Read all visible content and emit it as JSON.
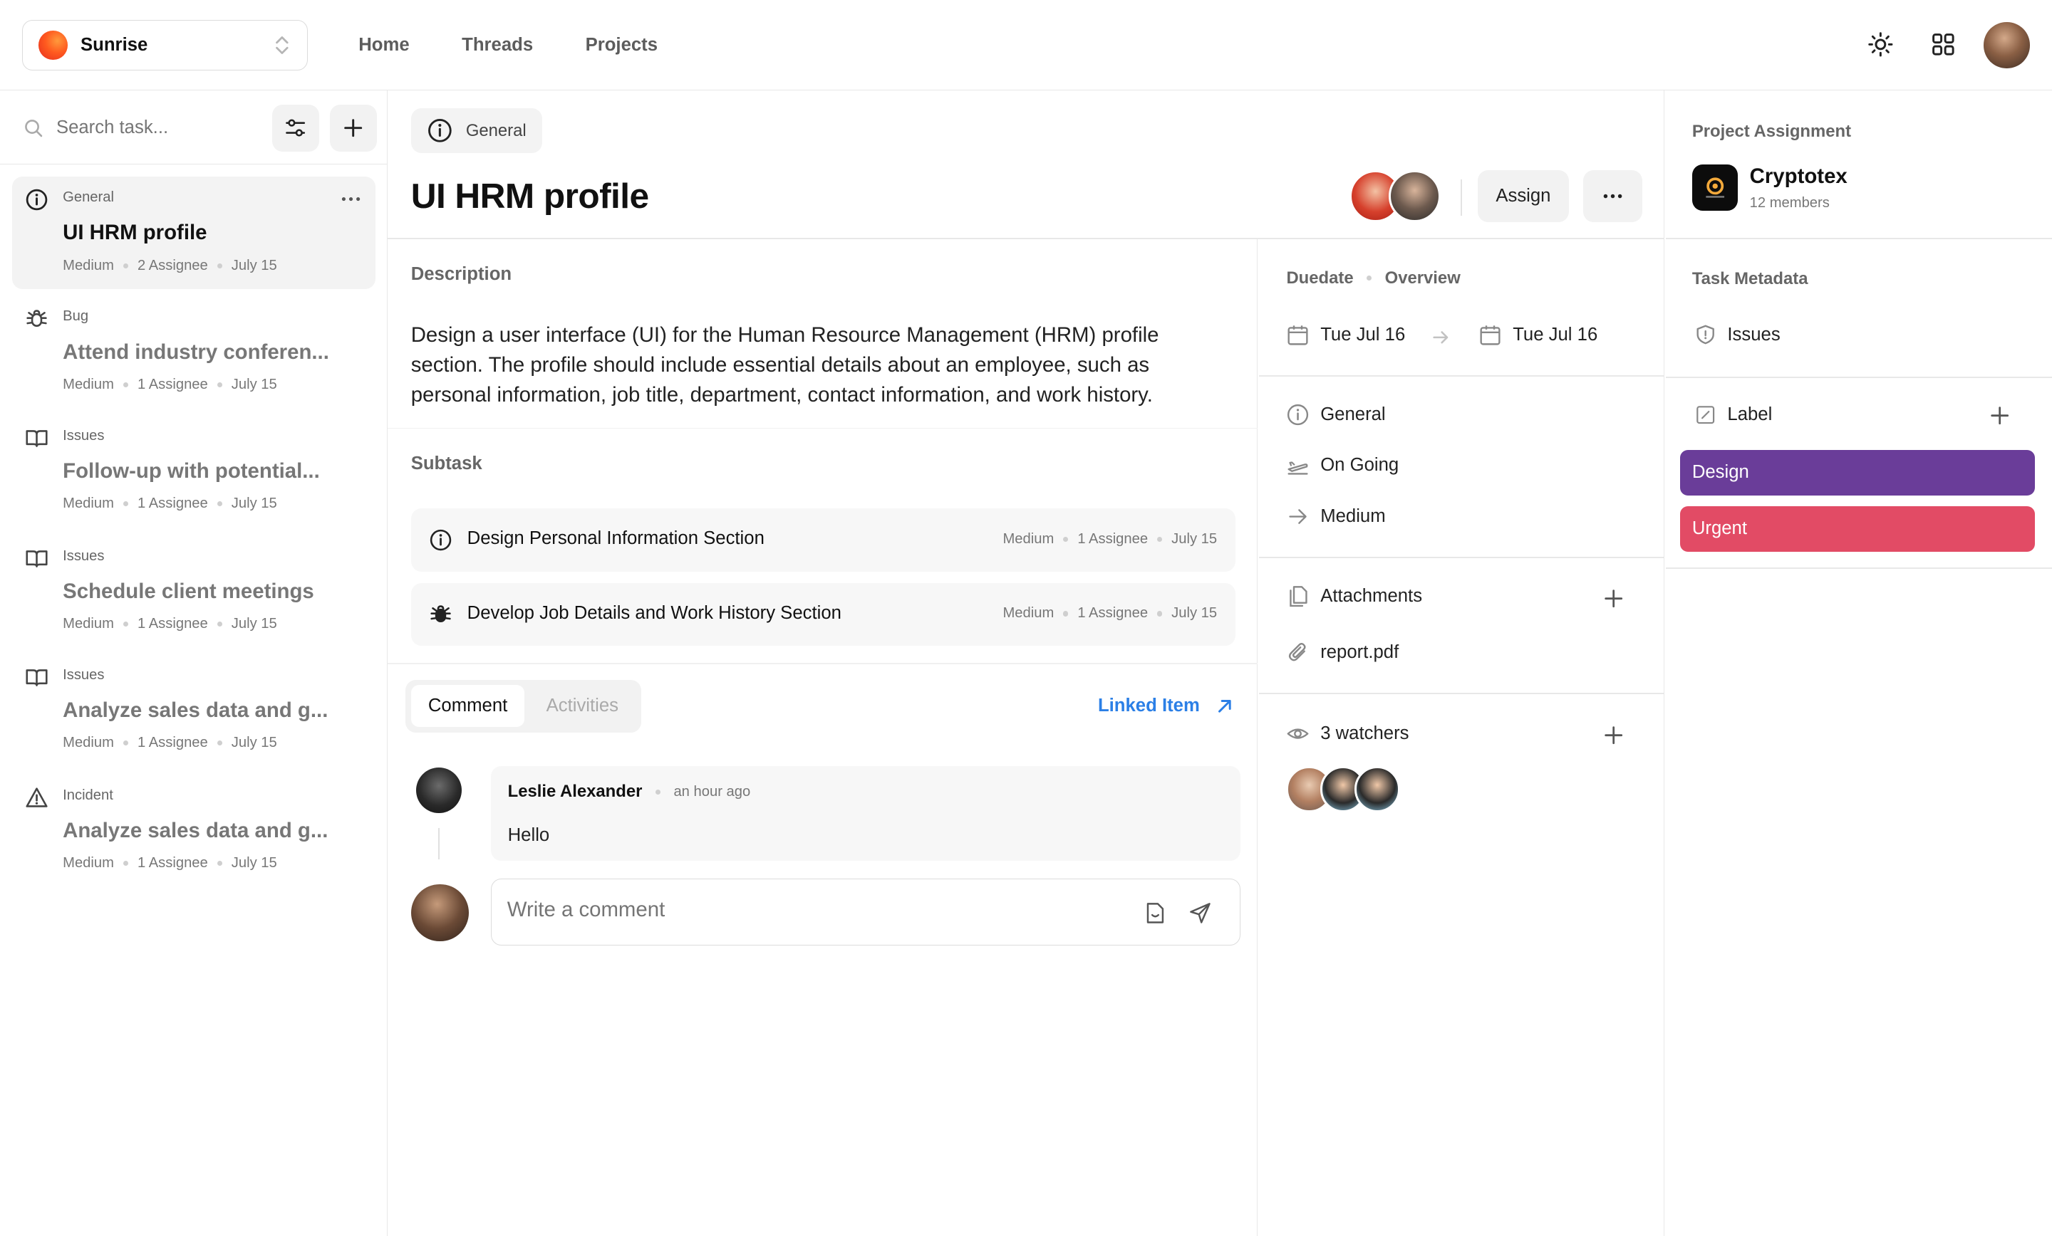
{
  "workspace": {
    "name": "Sunrise"
  },
  "nav": [
    "Home",
    "Threads",
    "Projects"
  ],
  "search": {
    "placeholder": "Search task..."
  },
  "tasks": [
    {
      "category": "General",
      "title": "UI HRM profile",
      "priority": "Medium",
      "assignee": "2 Assignee",
      "date": "July 15",
      "icon": "info-icon"
    },
    {
      "category": "Bug",
      "title": "Attend industry conferen...",
      "priority": "Medium",
      "assignee": "1 Assignee",
      "date": "July 15",
      "icon": "bug-icon"
    },
    {
      "category": "Issues",
      "title": "Follow-up with potential...",
      "priority": "Medium",
      "assignee": "1 Assignee",
      "date": "July 15",
      "icon": "book-icon"
    },
    {
      "category": "Issues",
      "title": "Schedule client meetings",
      "priority": "Medium",
      "assignee": "1 Assignee",
      "date": "July 15",
      "icon": "book-icon"
    },
    {
      "category": "Issues",
      "title": "Analyze sales data and g...",
      "priority": "Medium",
      "assignee": "1 Assignee",
      "date": "July 15",
      "icon": "book-icon"
    },
    {
      "category": "Incident",
      "title": "Analyze sales data and g...",
      "priority": "Medium",
      "assignee": "1 Assignee",
      "date": "July 15",
      "icon": "warning-icon"
    }
  ],
  "detail": {
    "category": "General",
    "title": "UI HRM profile",
    "assign_label": "Assign",
    "description_label": "Description",
    "description": "Design a user interface (UI) for the Human Resource Management (HRM) profile section. The profile should include essential details about an employee, such as personal information, job title, department, contact information, and work history.",
    "subtask_label": "Subtask",
    "subtasks": [
      {
        "title": "Design Personal Information Section",
        "priority": "Medium",
        "assignee": "1 Assignee",
        "date": "July 15",
        "icon": "info-icon"
      },
      {
        "title": "Develop Job Details and Work History Section",
        "priority": "Medium",
        "assignee": "1 Assignee",
        "date": "July 15",
        "icon": "bug-icon"
      }
    ],
    "tabs": {
      "comment": "Comment",
      "activities": "Activities"
    },
    "linked_item": "Linked Item",
    "comment": {
      "author": "Leslie Alexander",
      "time": "an hour ago",
      "text": "Hello"
    },
    "comment_placeholder": "Write a comment"
  },
  "meta": {
    "tab_duedate": "Duedate",
    "tab_overview": "Overview",
    "start_date": "Tue Jul 16",
    "end_date": "Tue Jul 16",
    "type": "General",
    "status": "On Going",
    "priority": "Medium",
    "attachments_label": "Attachments",
    "attachment_file": "report.pdf",
    "watchers_label": "3 watchers"
  },
  "right": {
    "assignment_label": "Project Assignment",
    "project_name": "Cryptotex",
    "project_members": "12 members",
    "metadata_label": "Task Metadata",
    "issue_type": "Issues",
    "label_title": "Label",
    "labels": [
      {
        "name": "Design",
        "color": "#6a3d99"
      },
      {
        "name": "Urgent",
        "color": "#e24b65"
      }
    ]
  },
  "colors": {
    "accent_link": "#2b7fe6",
    "brand_orange": "#ff5a1f"
  }
}
